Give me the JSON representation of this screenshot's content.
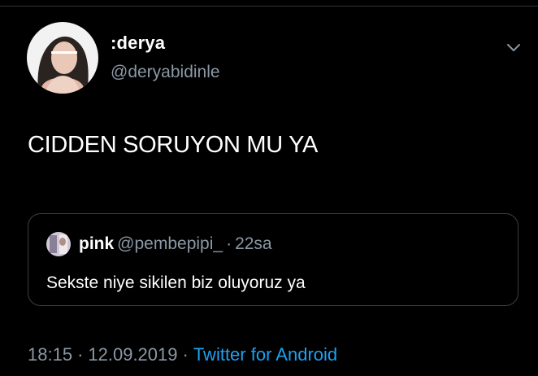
{
  "tweet": {
    "author": {
      "display_name": ":derya",
      "handle": "@deryabidinle"
    },
    "text": "CIDDEN SORUYON MU YA",
    "quoted_tweet": {
      "author_name": "pink",
      "author_handle": "@pembepipi_",
      "separator": "·",
      "time": "22sa",
      "text": "Sekste niye sikilen biz oluyoruz ya"
    },
    "meta": {
      "time": "18:15",
      "separator": "·",
      "date": "12.09.2019",
      "source": "Twitter for Android"
    }
  },
  "icons": {
    "menu": "chevron-down-icon"
  },
  "colors": {
    "background": "#000000",
    "text_primary": "#ffffff",
    "text_secondary": "#8b98a5",
    "link": "#1da1f2",
    "border": "#3a3f44"
  }
}
